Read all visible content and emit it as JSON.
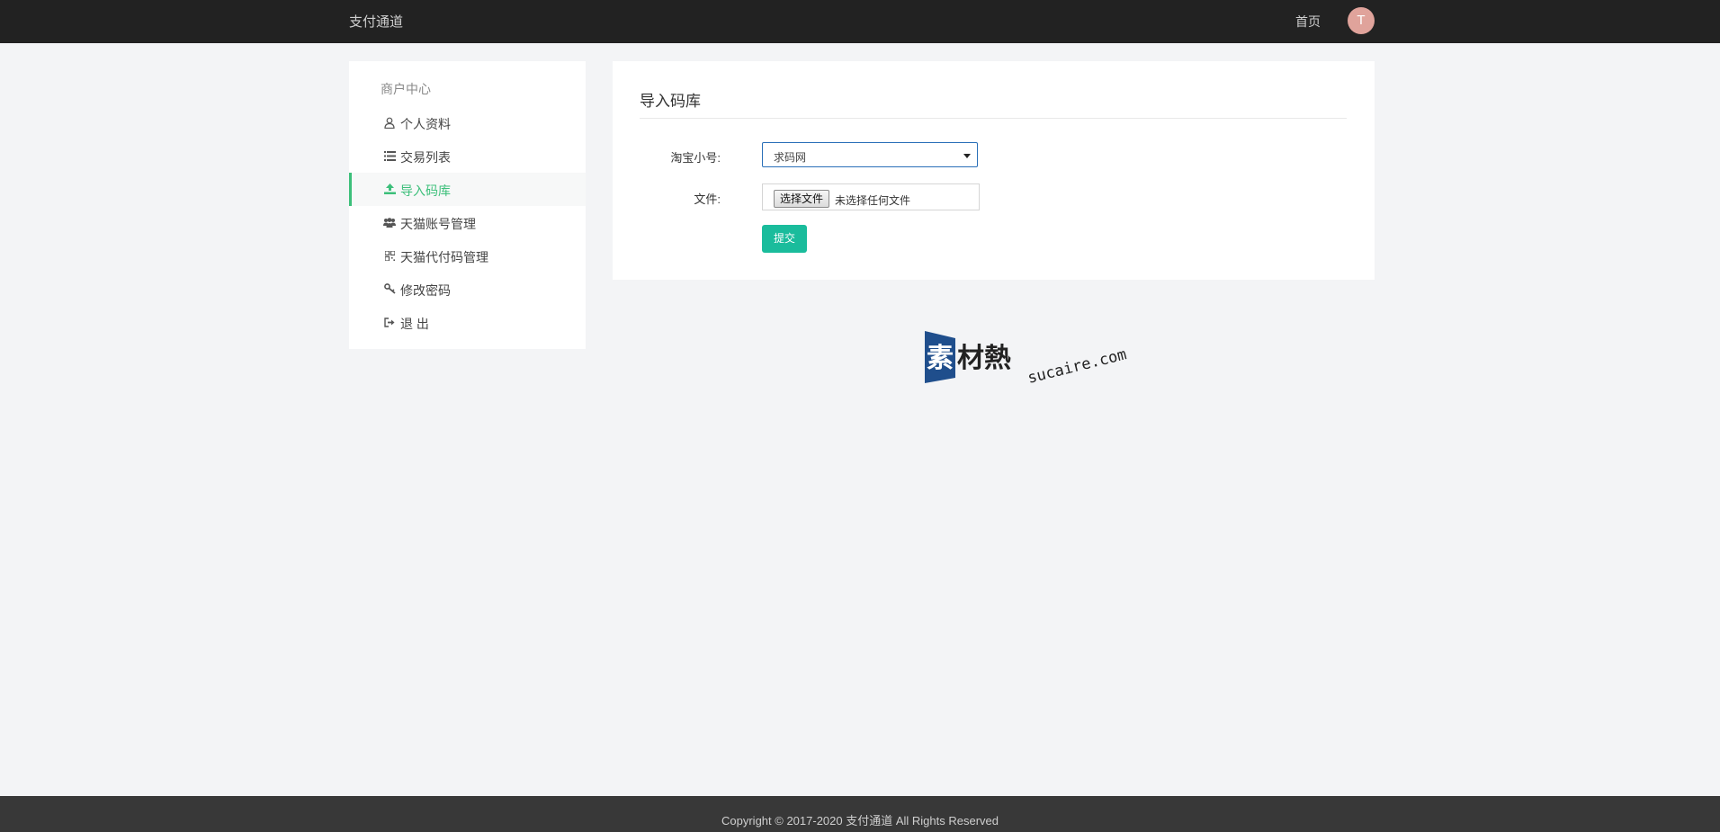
{
  "header": {
    "brand": "支付通道",
    "nav_home": "首页",
    "avatar_initial": "T",
    "avatar_color": "#e0a39b"
  },
  "sidebar": {
    "heading": "商户中心",
    "items": [
      {
        "label": "个人资料",
        "icon": "user-icon"
      },
      {
        "label": "交易列表",
        "icon": "list-icon"
      },
      {
        "label": "导入码库",
        "icon": "upload-icon",
        "active": true
      },
      {
        "label": "天猫账号管理",
        "icon": "users-icon"
      },
      {
        "label": "天猫代付码管理",
        "icon": "qrcode-icon"
      },
      {
        "label": "修改密码",
        "icon": "key-icon"
      },
      {
        "label": "退 出",
        "icon": "sign-out-icon"
      }
    ],
    "accent_color": "#3cbf7a"
  },
  "panel": {
    "title": "导入码库",
    "fields": {
      "taobao_label": "淘宝小号:",
      "taobao_value": "求码网",
      "file_label": "文件:",
      "file_button": "选择文件",
      "file_status": "未选择任何文件"
    },
    "submit_label": "提交",
    "submit_color": "#1abc9c"
  },
  "watermark": {
    "cn": "素材熱",
    "en": "sucaire.com"
  },
  "footer": {
    "copyright": "Copyright © 2017-2020 支付通道 All Rights Reserved"
  }
}
